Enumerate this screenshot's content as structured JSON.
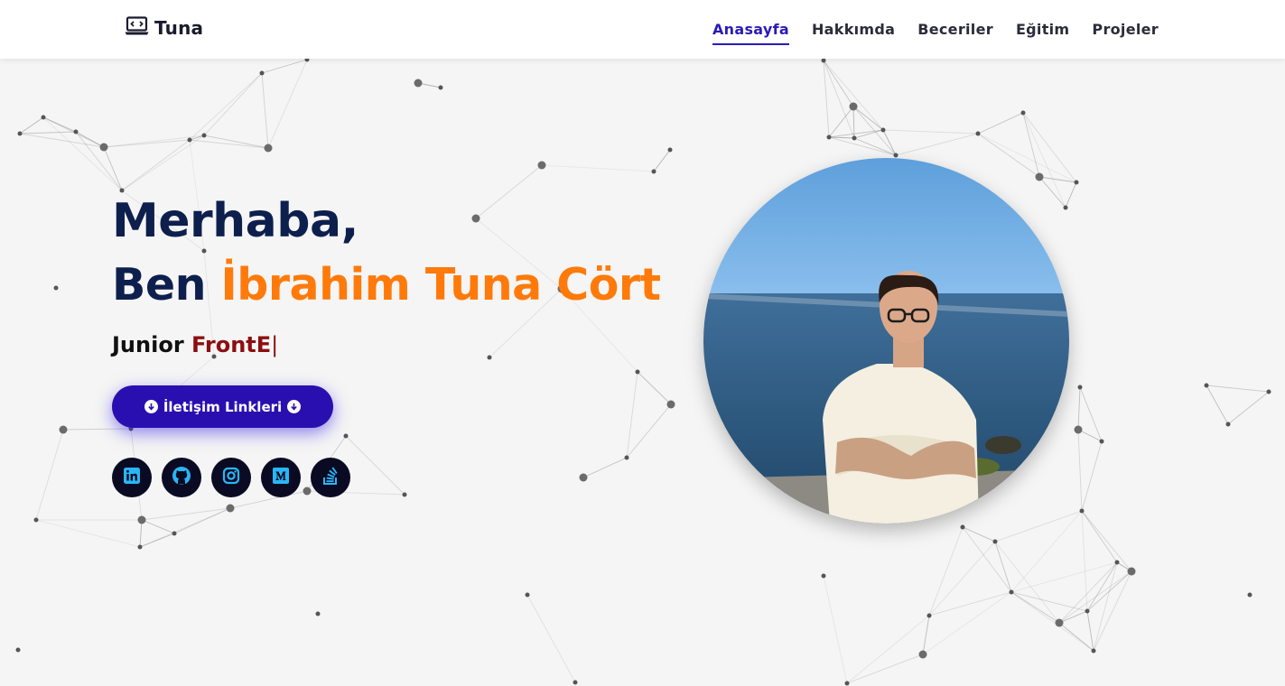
{
  "header": {
    "brand": {
      "icon": "laptop-code-icon",
      "text": "Tuna"
    },
    "nav": [
      {
        "label": "Anasayfa",
        "active": true
      },
      {
        "label": "Hakkımda",
        "active": false
      },
      {
        "label": "Beceriler",
        "active": false
      },
      {
        "label": "Eğitim",
        "active": false
      },
      {
        "label": "Projeler",
        "active": false
      }
    ]
  },
  "hero": {
    "greeting": "Merhaba,",
    "name_prefix": "Ben ",
    "name": "İbrahim Tuna Cört",
    "role_prefix": "Junior ",
    "role_typed": "FrontE",
    "cursor": "|",
    "contact_button": {
      "label": "İletişim Linkleri",
      "icon": "arrow-circle-down-icon"
    },
    "socials": [
      {
        "name": "linkedin",
        "icon": "linkedin-icon"
      },
      {
        "name": "github",
        "icon": "github-icon"
      },
      {
        "name": "instagram",
        "icon": "instagram-icon"
      },
      {
        "name": "medium",
        "icon": "medium-icon"
      },
      {
        "name": "stackoverflow",
        "icon": "stackoverflow-icon"
      }
    ],
    "photo": {
      "subject": "profile-photo"
    }
  },
  "colors": {
    "brand_navy": "#0d1f4d",
    "accent_orange": "#ff7a0a",
    "typed_red": "#8c0f0f",
    "button_indigo": "#2a0fb0",
    "nav_active": "#2a1bb8",
    "social_bg": "#0a0a23",
    "social_icon": "#29b6f6"
  }
}
